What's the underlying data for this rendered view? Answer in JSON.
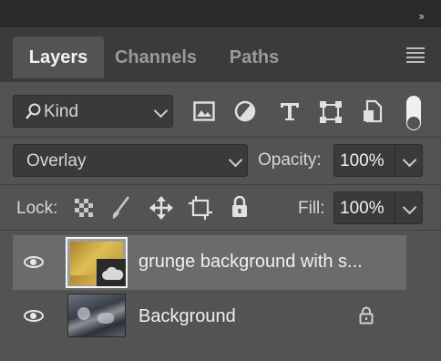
{
  "panel": {
    "tabs": [
      {
        "label": "Layers",
        "active": true
      },
      {
        "label": "Channels",
        "active": false
      },
      {
        "label": "Paths",
        "active": false
      }
    ]
  },
  "filter": {
    "kind_label": "Kind",
    "icons": [
      "image-filter-icon",
      "adjustment-filter-icon",
      "type-filter-icon",
      "shape-filter-icon",
      "smart-object-filter-icon",
      "filter-toggle-icon"
    ]
  },
  "blend": {
    "mode": "Overlay",
    "opacity_label": "Opacity:",
    "opacity_value": "100%"
  },
  "lock": {
    "label": "Lock:",
    "fill_label": "Fill:",
    "fill_value": "100%"
  },
  "layers": [
    {
      "name": "grunge background with s...",
      "selected": true,
      "visible": true,
      "smart_object": true
    },
    {
      "name": "Background",
      "selected": false,
      "visible": true,
      "locked": true
    }
  ],
  "colors": {
    "panel": "#535353",
    "tabstrip": "#3b3b3b",
    "selected_row": "#6b6b6b",
    "field": "#3a3a3a"
  }
}
